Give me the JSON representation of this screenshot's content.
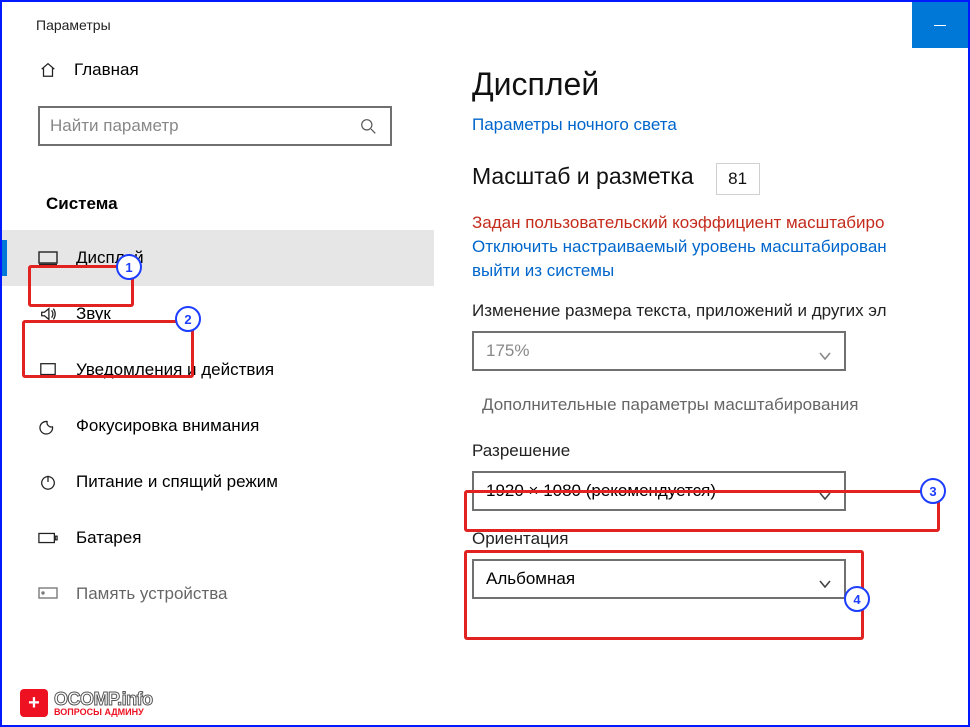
{
  "window_title": "Параметры",
  "home_label": "Главная",
  "search_placeholder": "Найти параметр",
  "category": "Система",
  "nav": {
    "display": "Дисплей",
    "sound": "Звук",
    "notifications": "Уведомления и действия",
    "focus": "Фокусировка внимания",
    "power": "Питание и спящий режим",
    "battery": "Батарея",
    "storage": "Память устройства"
  },
  "main": {
    "h1": "Дисплей",
    "nightlight_link": "Параметры ночного света",
    "scale_heading": "Масштаб и разметка",
    "scale_value": "81",
    "warn_text": "Задан пользовательский коэффициент масштабиро",
    "signout_link1": "Отключить настраиваемый уровень масштабирован",
    "signout_link2": "выйти из системы",
    "scale_label": "Изменение размера текста, приложений и других эл",
    "scale_dd": "175%",
    "advanced": "Дополнительные параметры масштабирования",
    "res_label": "Разрешение",
    "res_dd": "1920 × 1080 (рекомендуется)",
    "orient_label": "Ориентация",
    "orient_dd": "Альбомная"
  },
  "badges": {
    "b1": "1",
    "b2": "2",
    "b3": "3",
    "b4": "4"
  },
  "watermark": {
    "l1": "OCOMP.info",
    "l2": "ВОПРОСЫ АДМИНУ"
  }
}
